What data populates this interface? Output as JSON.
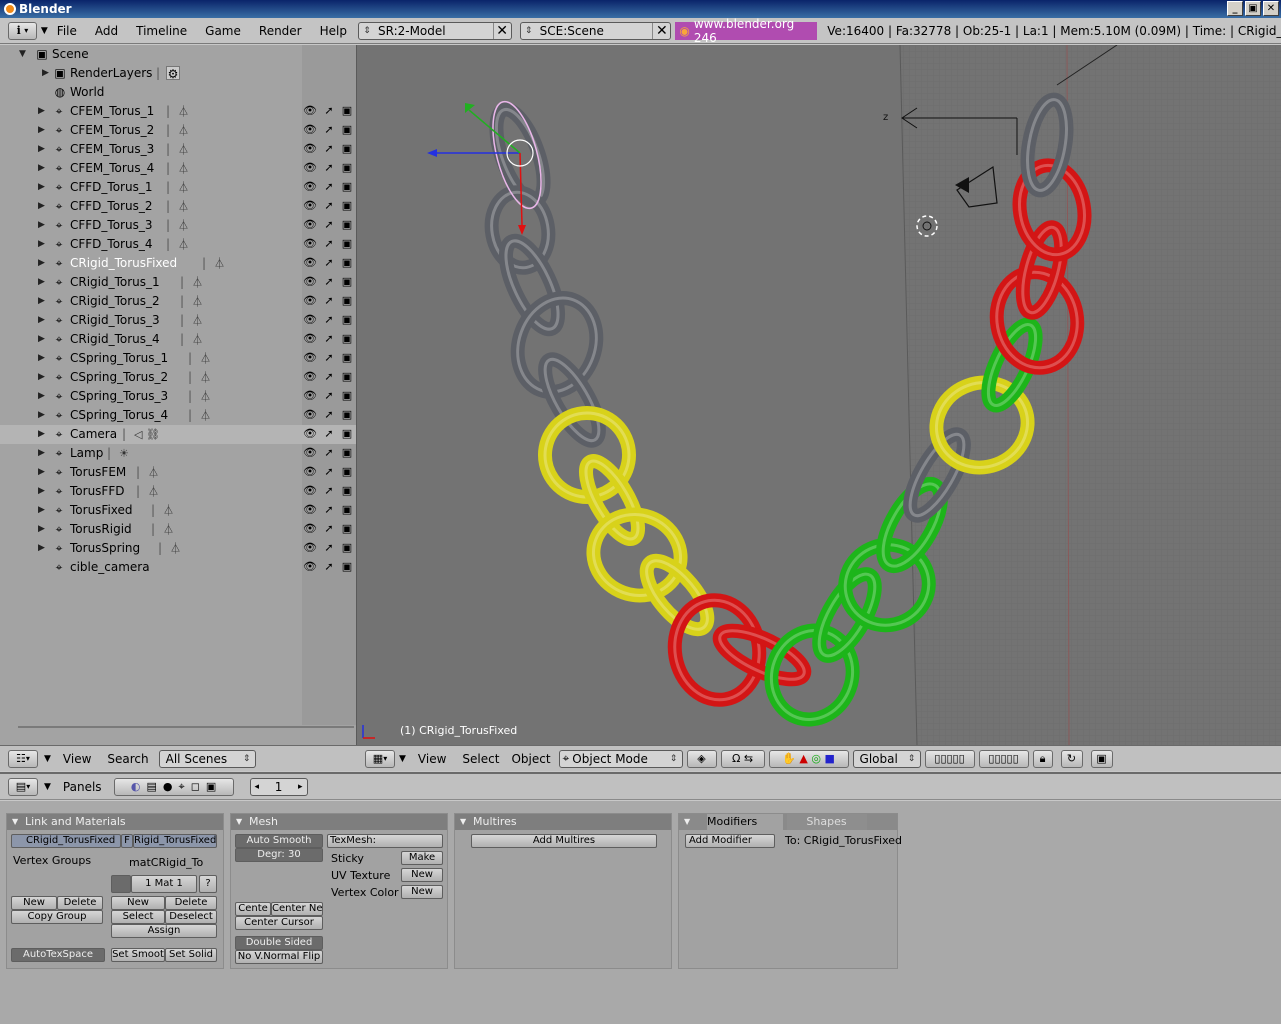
{
  "titlebar": {
    "title": "Blender"
  },
  "topheader": {
    "menus": [
      "File",
      "Add",
      "Timeline",
      "Game",
      "Render",
      "Help"
    ],
    "screen": "SR:2-Model",
    "scene": "SCE:Scene",
    "link": "www.blender.org 246",
    "stats": "Ve:16400 | Fa:32778 | Ob:25-1 | La:1  | Mem:5.10M (0.09M)  | Time: | CRigid_Tor"
  },
  "outliner": {
    "scene_label": "Scene",
    "render_layers": "RenderLayers",
    "world": "World",
    "objects": [
      "CFEM_Torus_1",
      "CFEM_Torus_2",
      "CFEM_Torus_3",
      "CFEM_Torus_4",
      "CFFD_Torus_1",
      "CFFD_Torus_2",
      "CFFD_Torus_3",
      "CFFD_Torus_4",
      "CRigid_TorusFixed",
      "CRigid_Torus_1",
      "CRigid_Torus_2",
      "CRigid_Torus_3",
      "CRigid_Torus_4",
      "CSpring_Torus_1",
      "CSpring_Torus_2",
      "CSpring_Torus_3",
      "CSpring_Torus_4",
      "Camera",
      "Lamp",
      "TorusFEM",
      "TorusFFD",
      "TorusFixed",
      "TorusRigid",
      "TorusSpring",
      "cible_camera"
    ],
    "header": {
      "view": "View",
      "search": "Search",
      "filter": "All Scenes"
    }
  },
  "viewport": {
    "object_label": "(1) CRigid_TorusFixed",
    "axis_label": "z",
    "header": {
      "view": "View",
      "select": "Select",
      "object": "Object",
      "mode": "Object Mode",
      "orientation": "Global"
    },
    "colors": {
      "gray": "#5c5f66",
      "yellow": "#d8d21a",
      "green": "#1db51a",
      "red": "#d31515"
    }
  },
  "buttons": {
    "header": {
      "panels": "Panels",
      "frame": "1"
    },
    "link_materials": {
      "title": "Link and Materials",
      "mesh_name": "CRigid_TorusFixed",
      "f_label": "F",
      "obj_name": "Rigid_TorusFixed",
      "vertex_groups": "Vertex Groups",
      "mat_name": "matCRigid_To",
      "mat_counter": "1 Mat 1",
      "question": "?",
      "new": "New",
      "delete": "Delete",
      "copy_group": "Copy Group",
      "new2": "New",
      "delete2": "Delete",
      "select": "Select",
      "deselect": "Deselect",
      "assign": "Assign",
      "autotexspace": "AutoTexSpace",
      "set_smooth": "Set Smoot",
      "set_solid": "Set Solid"
    },
    "mesh": {
      "title": "Mesh",
      "auto_smooth": "Auto Smooth",
      "degr": "Degr: 30",
      "texmesh": "TexMesh:",
      "sticky": "Sticky",
      "make": "Make",
      "uv_texture": "UV Texture",
      "new_uv": "New",
      "vertex_color": "Vertex Color",
      "new_vc": "New",
      "centre": "Cente",
      "centre_new": "Center Ne",
      "centre_cursor": "Center Cursor",
      "double_sided": "Double Sided",
      "no_vnormal_flip": "No V.Normal Flip"
    },
    "multires": {
      "title": "Multires",
      "add": "Add Multires"
    },
    "modifiers": {
      "tab_modifiers": "Modifiers",
      "tab_shapes": "Shapes",
      "add": "Add Modifier",
      "to": "To: CRigid_TorusFixed"
    }
  }
}
